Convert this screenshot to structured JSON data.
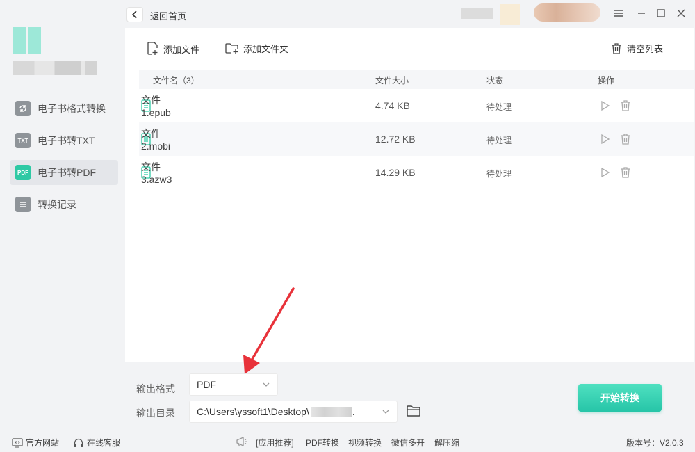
{
  "topbar": {
    "back_label": "返回首页"
  },
  "sidebar": {
    "items": [
      {
        "label": "电子书格式转换",
        "icon": "convert-icon",
        "icon_text": ""
      },
      {
        "label": "电子书转TXT",
        "icon": "txt-icon",
        "icon_text": "TXT"
      },
      {
        "label": "电子书转PDF",
        "icon": "pdf-icon",
        "icon_text": "PDF",
        "active": true
      },
      {
        "label": "转换记录",
        "icon": "history-icon",
        "icon_text": ""
      }
    ]
  },
  "toolbar": {
    "add_file": "添加文件",
    "add_folder": "添加文件夹",
    "clear_list": "清空列表"
  },
  "table": {
    "headers": {
      "name": "文件名（3）",
      "size": "文件大小",
      "status": "状态",
      "action": "操作"
    },
    "rows": [
      {
        "name": "文件1.epub",
        "size": "4.74 KB",
        "status": "待处理"
      },
      {
        "name": "文件2.mobi",
        "size": "12.72 KB",
        "status": "待处理"
      },
      {
        "name": "文件3.azw3",
        "size": "14.29 KB",
        "status": "待处理"
      }
    ]
  },
  "options": {
    "format_label": "输出格式",
    "format_value": "PDF",
    "dir_label": "输出目录",
    "dir_value": "C:\\Users\\yssoft1\\Desktop\\",
    "dir_suffix": ".",
    "start_button": "开始转换"
  },
  "footer": {
    "website": "官方网站",
    "service": "在线客服",
    "apps_label": "[应用推荐]",
    "apps": [
      "PDF转换",
      "视频转换",
      "微信多开",
      "解压缩"
    ],
    "version": "版本号：V2.0.3"
  },
  "colors": {
    "accent": "#2ec9a4",
    "annotation": "#e8323a"
  }
}
